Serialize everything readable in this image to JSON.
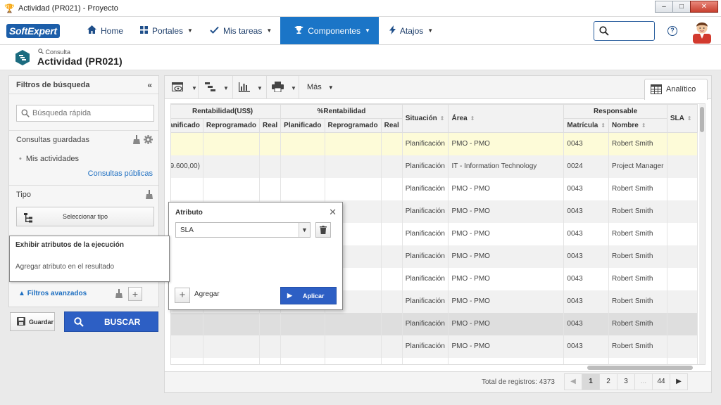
{
  "window": {
    "title": "Actividad (PR021) - Proyecto"
  },
  "nav": {
    "logo": {
      "part1": "Soft",
      "part2": "Expert"
    },
    "items": [
      {
        "label": "Home",
        "icon": "home-icon"
      },
      {
        "label": "Portales",
        "icon": "grid-icon"
      },
      {
        "label": "Mis tareas",
        "icon": "check-icon"
      },
      {
        "label": "Componentes",
        "icon": "trophy-icon",
        "active": true
      },
      {
        "label": "Atajos",
        "icon": "bolt-icon"
      }
    ]
  },
  "page": {
    "breadcrumb": "Consulta",
    "title": "Actividad (PR021)"
  },
  "filters": {
    "title": "Filtros de búsqueda",
    "quick_search_placeholder": "Búsqueda rápida",
    "saved_title": "Consultas guardadas",
    "saved_item": "Mis actividades",
    "public_link": "Consultas públicas",
    "tipo_title": "Tipo",
    "select_tipo": "Seleccionar tipo",
    "advanced": "Filtros avanzados",
    "save_label": "Guardar",
    "search_label": "BUSCAR"
  },
  "toolbar": {
    "more": "Más",
    "tab_analitico": "Analítico"
  },
  "table": {
    "groups": {
      "rent_usd": "Rentabilidad(US$)",
      "rent_pct": "%Rentabilidad",
      "responsable": "Responsable"
    },
    "cols": {
      "planificado_cut": "anificado",
      "reprogramado": "Reprogramado",
      "real": "Real",
      "planificado": "Planificado",
      "situacion": "Situación",
      "area": "Área",
      "matricula": "Matrícula",
      "nombre": "Nombre",
      "sla": "SLA"
    },
    "rows": [
      {
        "c1": "",
        "situacion": "Planificación",
        "area": "PMO - PMO",
        "matricula": "0043",
        "nombre": "Robert Smith"
      },
      {
        "c1": "9.600,00)",
        "situacion": "Planificación",
        "area": "IT - Information Technology",
        "matricula": "0024",
        "nombre": "Project Manager"
      },
      {
        "c1": "",
        "situacion": "Planificación",
        "area": "PMO - PMO",
        "matricula": "0043",
        "nombre": "Robert Smith"
      },
      {
        "c1": "",
        "situacion": "Planificación",
        "area": "PMO - PMO",
        "matricula": "0043",
        "nombre": "Robert Smith"
      },
      {
        "c1": "",
        "situacion": "Planificación",
        "area": "PMO - PMO",
        "matricula": "0043",
        "nombre": "Robert Smith"
      },
      {
        "c1": "",
        "situacion": "Planificación",
        "area": "PMO - PMO",
        "matricula": "0043",
        "nombre": "Robert Smith"
      },
      {
        "c1": "",
        "situacion": "Planificación",
        "area": "PMO - PMO",
        "matricula": "0043",
        "nombre": "Robert Smith"
      },
      {
        "c1": "",
        "situacion": "Planificación",
        "area": "PMO - PMO",
        "matricula": "0043",
        "nombre": "Robert Smith"
      },
      {
        "c1": "",
        "situacion": "Planificación",
        "area": "PMO - PMO",
        "matricula": "0043",
        "nombre": "Robert Smith"
      },
      {
        "c1": "",
        "situacion": "Planificación",
        "area": "PMO - PMO",
        "matricula": "0043",
        "nombre": "Robert Smith"
      },
      {
        "c1": "",
        "situacion": "",
        "area": "",
        "matricula": "",
        "nombre": ""
      }
    ]
  },
  "footer": {
    "total": "Total de registros: 4373",
    "pages": [
      "1",
      "2",
      "3",
      "...",
      "44"
    ]
  },
  "callout": {
    "title": "Exhibir atributos de la ejecución",
    "text": "Agregar atributo en el resultado"
  },
  "popup": {
    "title": "Atributo",
    "selected": "SLA",
    "add_label": "Agregar",
    "apply_label": "Aplicar"
  },
  "colors": {
    "accent": "#1b75c7",
    "primary_button": "#2d5fc4",
    "row_highlight": "#fdfbd8"
  }
}
